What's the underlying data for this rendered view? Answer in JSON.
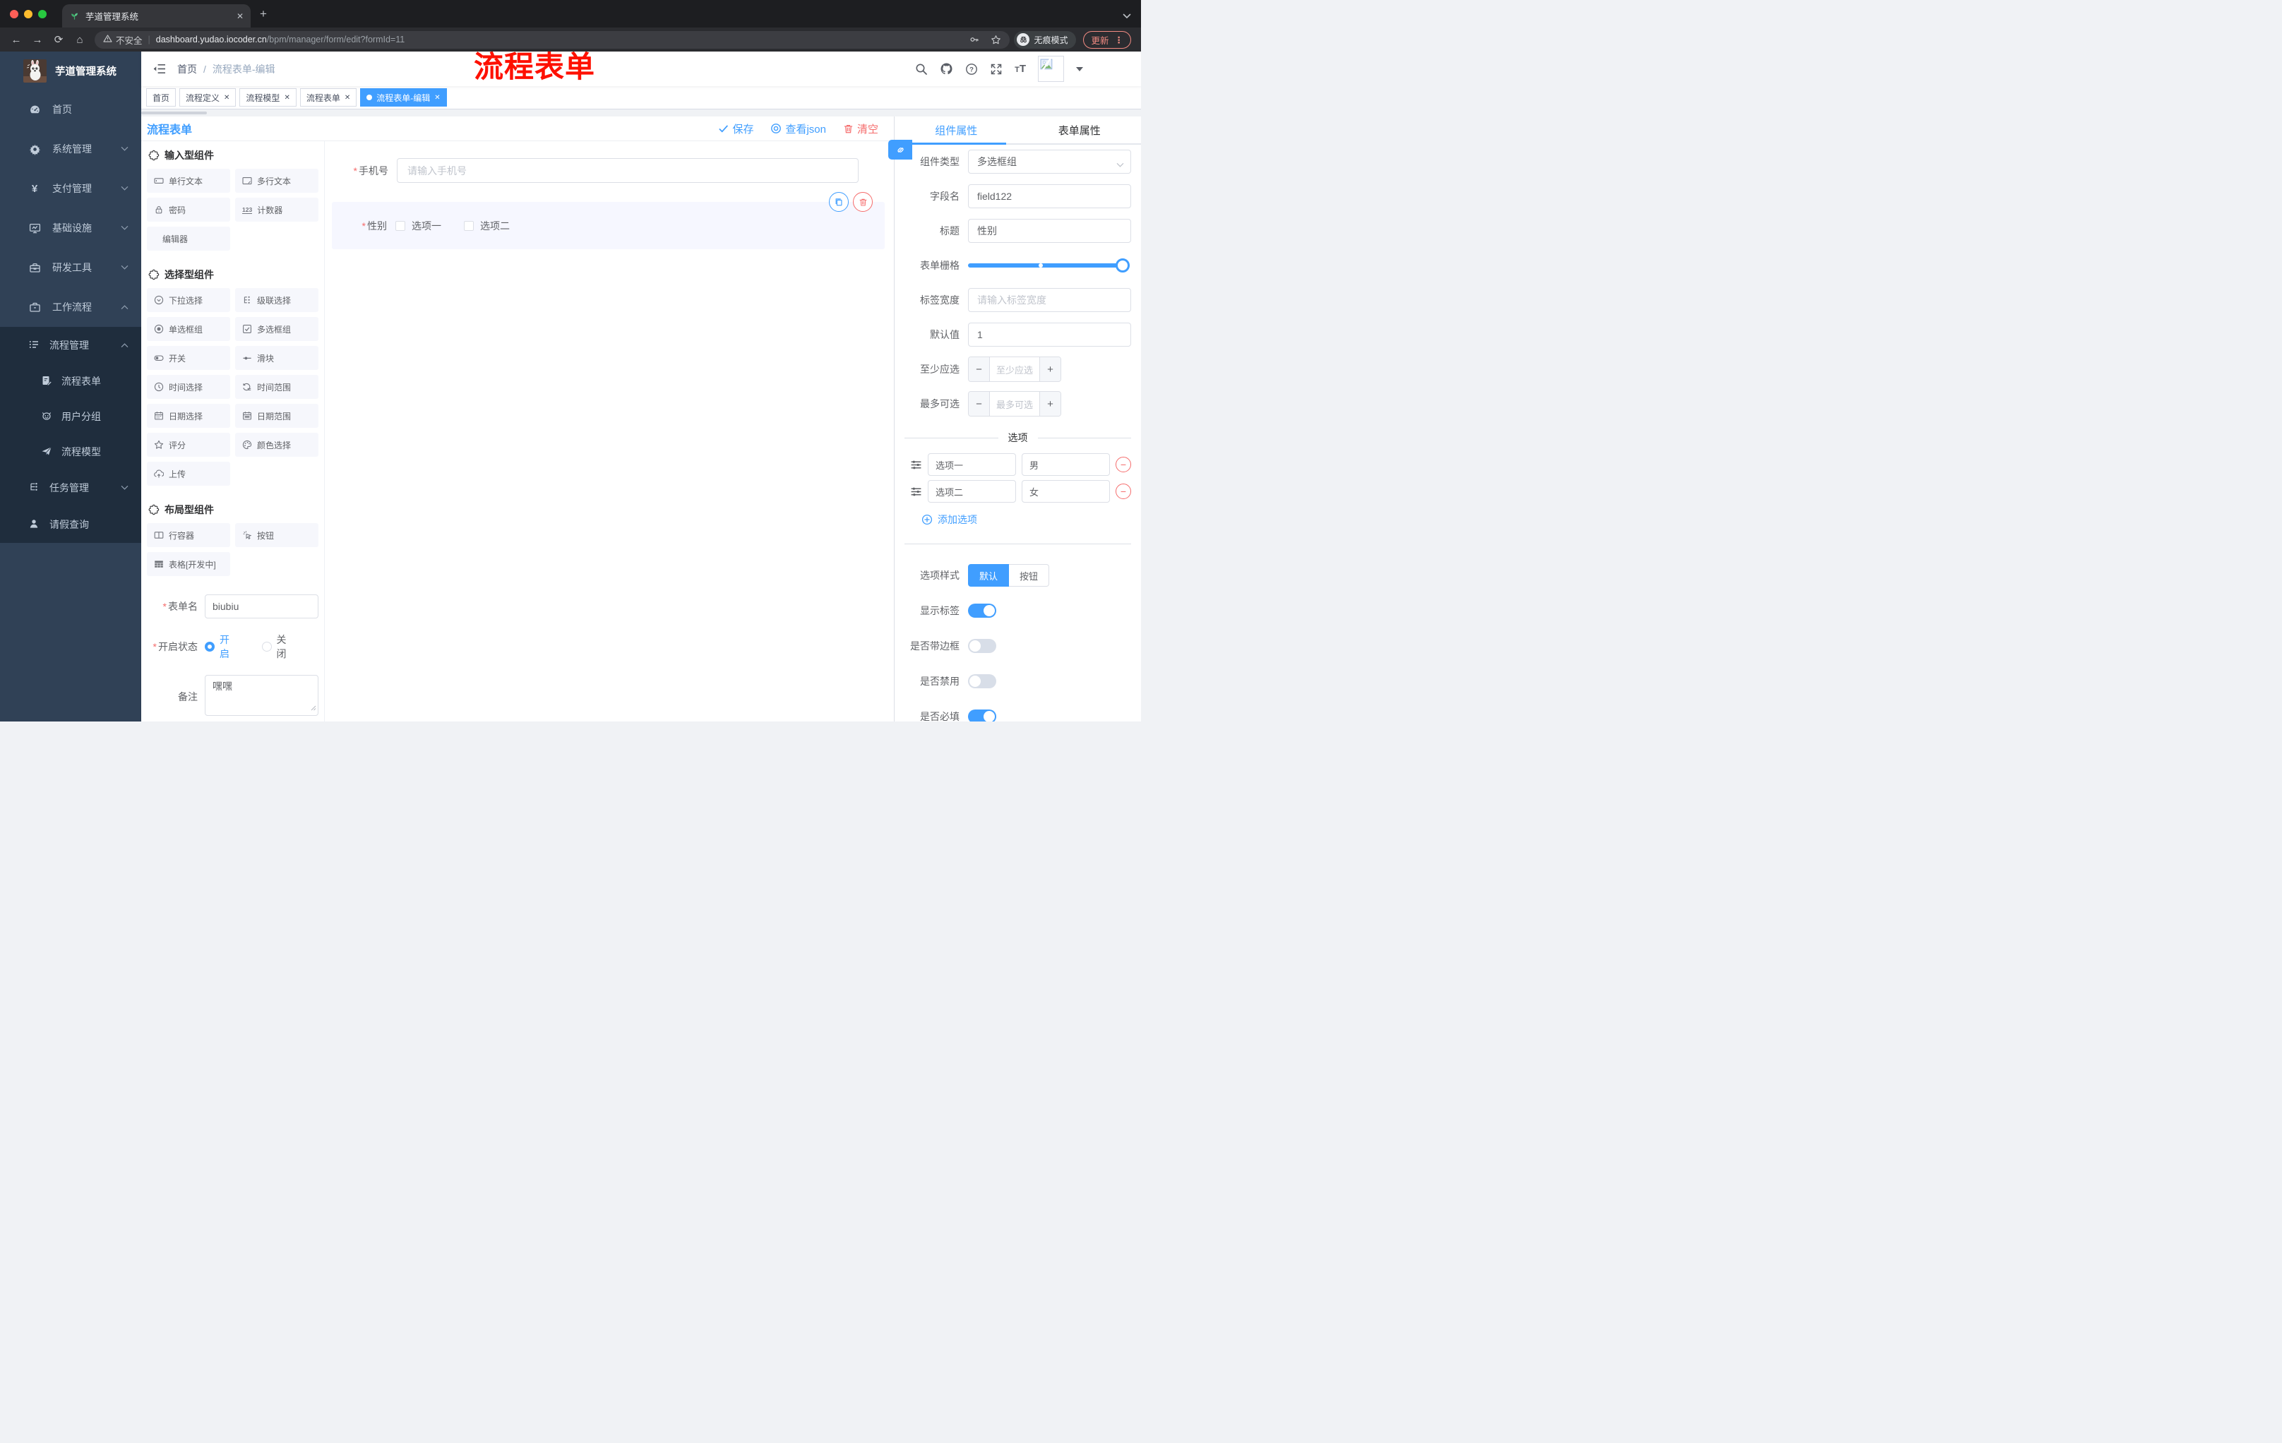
{
  "chrome": {
    "tab_title": "芋道管理系统",
    "security_label": "不安全",
    "url_domain": "dashboard.yudao.iocoder.cn",
    "url_path": "/bpm/manager/form/edit?formId=11",
    "incognito_label": "无痕模式",
    "update_label": "更新"
  },
  "sidebar": {
    "logo_title": "芋道管理系统",
    "items": [
      {
        "label": "首页"
      },
      {
        "label": "系统管理"
      },
      {
        "label": "支付管理"
      },
      {
        "label": "基础设施"
      },
      {
        "label": "研发工具"
      },
      {
        "label": "工作流程"
      }
    ],
    "submenu": {
      "group": "流程管理",
      "children": [
        {
          "label": "流程表单"
        },
        {
          "label": "用户分组"
        },
        {
          "label": "流程模型"
        }
      ],
      "siblings": [
        {
          "label": "任务管理"
        },
        {
          "label": "请假查询"
        }
      ]
    }
  },
  "navbar": {
    "breadcrumb_home": "首页",
    "breadcrumb_sep": "/",
    "breadcrumb_current": "流程表单-编辑",
    "annotation": "流程表单"
  },
  "tags": [
    {
      "label": "首页"
    },
    {
      "label": "流程定义"
    },
    {
      "label": "流程模型"
    },
    {
      "label": "流程表单"
    },
    {
      "label": "流程表单-编辑"
    }
  ],
  "work": {
    "title": "流程表单",
    "save": "保存",
    "view_json": "查看json",
    "clear": "清空"
  },
  "palette": {
    "sections": [
      {
        "title": "输入型组件",
        "items": [
          {
            "label": "单行文本"
          },
          {
            "label": "多行文本"
          },
          {
            "label": "密码"
          },
          {
            "label": "计数器"
          },
          {
            "label": "编辑器"
          }
        ]
      },
      {
        "title": "选择型组件",
        "items": [
          {
            "label": "下拉选择"
          },
          {
            "label": "级联选择"
          },
          {
            "label": "单选框组"
          },
          {
            "label": "多选框组"
          },
          {
            "label": "开关"
          },
          {
            "label": "滑块"
          },
          {
            "label": "时间选择"
          },
          {
            "label": "时间范围"
          },
          {
            "label": "日期选择"
          },
          {
            "label": "日期范围"
          },
          {
            "label": "评分"
          },
          {
            "label": "颜色选择"
          },
          {
            "label": "上传"
          }
        ]
      },
      {
        "title": "布局型组件",
        "items": [
          {
            "label": "行容器"
          },
          {
            "label": "按钮"
          },
          {
            "label": "表格[开发中]"
          }
        ]
      }
    ]
  },
  "meta": {
    "form_name_label": "表单名",
    "form_name_value": "biubiu",
    "status_label": "开启状态",
    "status_on": "开启",
    "status_off": "关闭",
    "remark_label": "备注",
    "remark_value": "嘿嘿"
  },
  "canvas": {
    "phone_label": "手机号",
    "phone_placeholder": "请输入手机号",
    "gender_label": "性别",
    "gender_options": [
      {
        "label": "选项一"
      },
      {
        "label": "选项二"
      }
    ]
  },
  "panel": {
    "tab_component": "组件属性",
    "tab_form": "表单属性",
    "component_type_label": "组件类型",
    "component_type_value": "多选框组",
    "field_name_label": "字段名",
    "field_name_value": "field122",
    "title_label": "标题",
    "title_value": "性别",
    "grid_label": "表单栅格",
    "label_width_label": "标签宽度",
    "label_width_placeholder": "请输入标签宽度",
    "default_label": "默认值",
    "default_value": "1",
    "min_label": "至少应选",
    "min_placeholder": "至少应选",
    "max_label": "最多可选",
    "max_placeholder": "最多可选",
    "options_title": "选项",
    "options": [
      {
        "label": "选项一",
        "value": "男"
      },
      {
        "label": "选项二",
        "value": "女"
      }
    ],
    "add_option": "添加选项",
    "style_label": "选项样式",
    "style_default": "默认",
    "style_button": "按钮",
    "show_label": "显示标签",
    "border_label": "是否带边框",
    "disabled_label": "是否禁用",
    "required_label": "是否必填"
  },
  "colors": {
    "primary": "#409eff",
    "danger": "#f56c6c",
    "sidebar": "#304156",
    "submenu": "#1f2d3d"
  }
}
